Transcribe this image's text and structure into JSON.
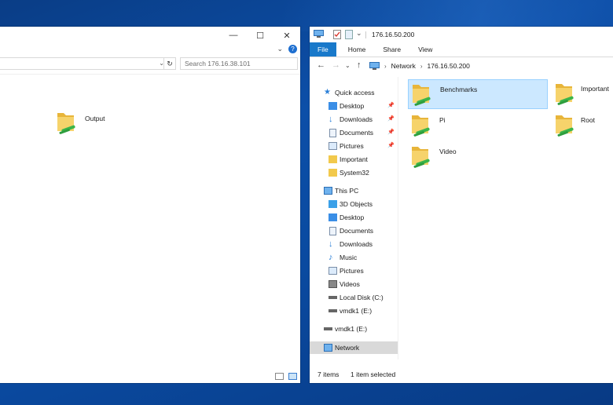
{
  "left_window": {
    "search_placeholder": "Search 176.16.38.101",
    "items": [
      {
        "label": "Output"
      }
    ]
  },
  "right_window": {
    "title": "176.16.50.200",
    "tabs": [
      {
        "label": "File"
      },
      {
        "label": "Home"
      },
      {
        "label": "Share"
      },
      {
        "label": "View"
      }
    ],
    "breadcrumb": [
      {
        "label": "Network"
      },
      {
        "label": "176.16.50.200"
      }
    ],
    "nav": {
      "quick_access": {
        "label": "Quick access"
      },
      "quick_items": [
        {
          "label": "Desktop",
          "icon": "desktop-icon",
          "pinned": true
        },
        {
          "label": "Downloads",
          "icon": "download-arrow-icon",
          "pinned": true
        },
        {
          "label": "Documents",
          "icon": "document-icon",
          "pinned": true
        },
        {
          "label": "Pictures",
          "icon": "pictures-icon",
          "pinned": true
        },
        {
          "label": "Important",
          "icon": "folder-icon",
          "pinned": false
        },
        {
          "label": "System32",
          "icon": "folder-icon",
          "pinned": false
        }
      ],
      "this_pc": {
        "label": "This PC"
      },
      "pc_items": [
        {
          "label": "3D Objects",
          "icon": "cube-icon"
        },
        {
          "label": "Desktop",
          "icon": "desktop-icon"
        },
        {
          "label": "Documents",
          "icon": "document-icon"
        },
        {
          "label": "Downloads",
          "icon": "download-arrow-icon"
        },
        {
          "label": "Music",
          "icon": "music-note-icon"
        },
        {
          "label": "Pictures",
          "icon": "pictures-icon"
        },
        {
          "label": "Videos",
          "icon": "video-icon"
        },
        {
          "label": "Local Disk (C:)",
          "icon": "drive-icon"
        },
        {
          "label": "vmdk1 (E:)",
          "icon": "drive-icon"
        }
      ],
      "extra_drive": {
        "label": "vmdk1 (E:)"
      },
      "network": {
        "label": "Network"
      }
    },
    "items": [
      {
        "label": "Benchmarks",
        "selected": true
      },
      {
        "label": "Important",
        "selected": false
      },
      {
        "label": "Pi",
        "selected": false
      },
      {
        "label": "Root",
        "selected": false
      },
      {
        "label": "Video",
        "selected": false
      }
    ],
    "status": {
      "count": "7 items",
      "selection": "1 item selected"
    }
  },
  "colors": {
    "accent": "#1979ca",
    "selection": "#cce8ff",
    "folder": "#f2c94c",
    "share_badge": "#3bb54a"
  }
}
